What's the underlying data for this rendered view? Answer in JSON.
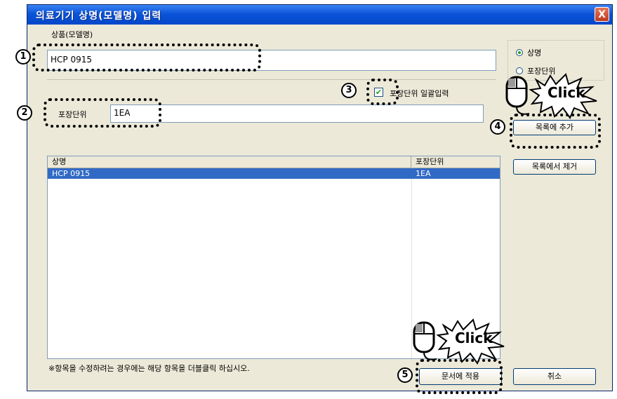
{
  "window": {
    "title": "의료기기 상명(모델명) 입력",
    "close_label": "X"
  },
  "product": {
    "label": "상품(모델명)",
    "value": "HCP 0915"
  },
  "radio": {
    "options": [
      {
        "label": "상명",
        "selected": true
      },
      {
        "label": "포장단위",
        "selected": false
      }
    ]
  },
  "checkbox": {
    "label": "포장단위 일괄입력",
    "checked": true,
    "mark": "✔"
  },
  "package": {
    "label": "포장단위",
    "value": "1EA"
  },
  "buttons": {
    "add": "목록에 추가",
    "remove": "목록에서 제거",
    "apply": "문서에 적용",
    "cancel": "취소"
  },
  "list": {
    "columns": [
      "상명",
      "포장단위"
    ],
    "rows": [
      {
        "name": "HCP 0915",
        "unit": "1EA",
        "selected": true
      }
    ]
  },
  "note": "※항목을 수정하려는 경우에는 해당 항목을 더블클릭 하십시오.",
  "callouts": [
    "1",
    "2",
    "3",
    "4",
    "5"
  ],
  "click_text": [
    "Click",
    "Click"
  ],
  "colors": {
    "title_bar": "#0b54d8",
    "selection": "#316ac5",
    "dialog_bg": "#ece9d8"
  }
}
